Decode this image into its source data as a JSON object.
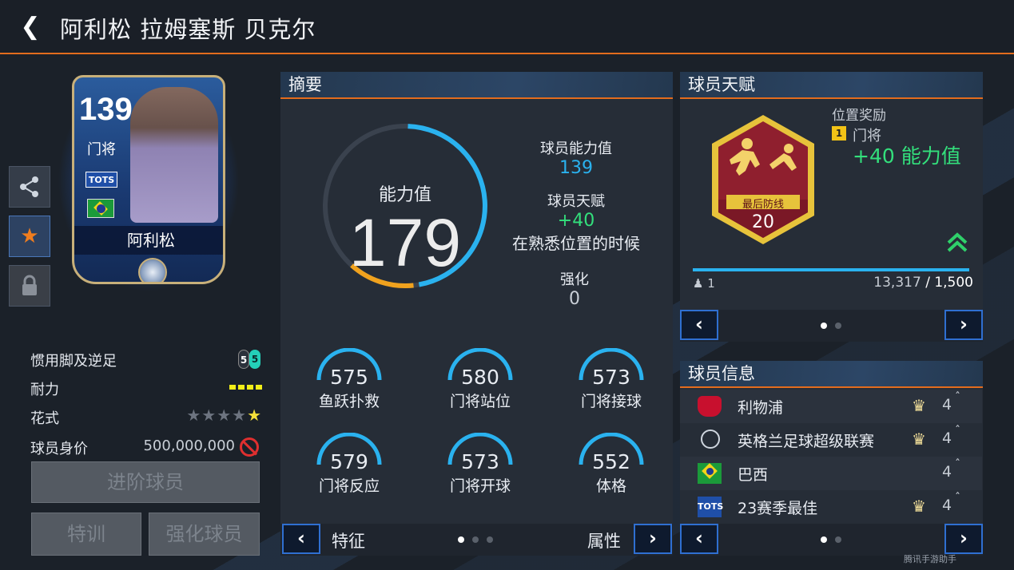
{
  "header": {
    "back_icon": "chevron-left-icon",
    "title": "阿利松 拉姆塞斯 贝克尔"
  },
  "card": {
    "rating": "139",
    "position": "门将",
    "badge": "TOTS",
    "name": "阿利松"
  },
  "side_buttons": [
    "share-icon",
    "star-icon",
    "lock-icon"
  ],
  "attributes": {
    "foot_label": "惯用脚及逆足",
    "foot_main": "5",
    "foot_weak": "5",
    "stamina_label": "耐力",
    "stamina_bars": 4,
    "skill_label": "花式",
    "skill_stars_on": 1,
    "skill_stars_total": 5,
    "price_label": "球员身价",
    "price_value": "500,000,000"
  },
  "buttons": {
    "advance": "进阶球员",
    "training": "特训",
    "enhance": "强化球员"
  },
  "summary": {
    "title": "摘要",
    "ring_label": "能力值",
    "ring_value": "179",
    "ring_value_num": 179,
    "ovr_label": "球员能力值",
    "ovr_value": "139",
    "talent_label": "球员天赋",
    "talent_value": "+40",
    "talent_note": "在熟悉位置的时候",
    "enhance_label": "强化",
    "enhance_value": "0",
    "stats": [
      {
        "value": "575",
        "name": "鱼跃扑救"
      },
      {
        "value": "580",
        "name": "门将站位"
      },
      {
        "value": "573",
        "name": "门将接球"
      },
      {
        "value": "579",
        "name": "门将反应"
      },
      {
        "value": "573",
        "name": "门将开球"
      },
      {
        "value": "552",
        "name": "体格"
      }
    ],
    "footer_left": "特征",
    "footer_right": "属性",
    "page": 1,
    "pages": 3
  },
  "talent": {
    "title": "球员天赋",
    "badge_name": "最后防线",
    "badge_level": "20",
    "reward_title": "位置奖励",
    "reward_rank": "1",
    "reward_position": "门将",
    "reward_value": "+40 能力值",
    "owner_count": "1",
    "progress_current": "13,317",
    "progress_sep": "/",
    "progress_total": "1,500",
    "page": 1,
    "pages": 2
  },
  "info": {
    "title": "球员信息",
    "rows": [
      {
        "icon": "liverpool-crest-icon",
        "text": "利物浦",
        "count": "4",
        "crown": true
      },
      {
        "icon": "premier-league-icon",
        "text": "英格兰足球超级联赛",
        "count": "4",
        "crown": true
      },
      {
        "icon": "brazil-flag-icon",
        "text": "巴西",
        "count": "4",
        "crown": false
      },
      {
        "icon": "tots-icon",
        "text": "23赛季最佳",
        "count": "4",
        "crown": true
      }
    ],
    "tots_label": "TOTS",
    "page": 1,
    "pages": 2
  },
  "watermark": "腾讯手游助手",
  "colors": {
    "accent_orange": "#e36c1d",
    "ring_blue": "#2ab2ef",
    "ring_orange": "#f0a21e",
    "green": "#33e07c",
    "nav_blue": "#2f6fd1"
  }
}
